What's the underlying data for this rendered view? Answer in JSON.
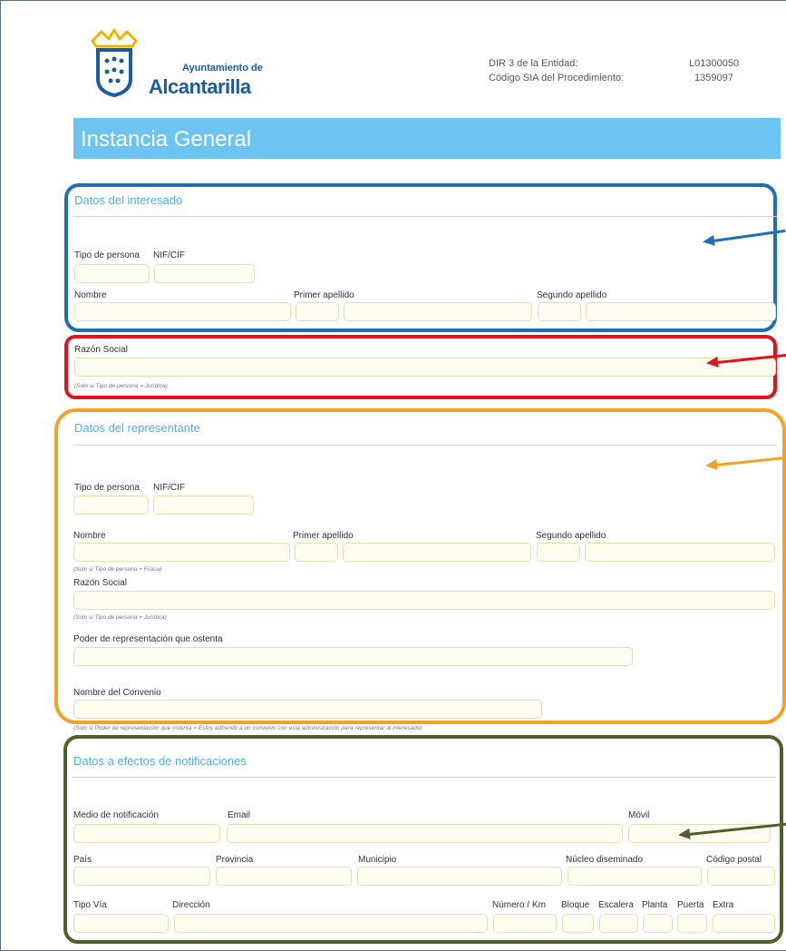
{
  "header": {
    "org_line1": "Ayuntamiento de",
    "org_line2": "Alcantarilla",
    "dir3_label": "DIR 3 de la Entidad:",
    "dir3_value": "L01300050",
    "sia_label": "Código SIA del Procedimiento:",
    "sia_value": "1359097"
  },
  "form_title": "Instancia General",
  "interesado": {
    "title": "Datos del interesado",
    "tipo_persona": "Tipo de persona",
    "nif": "NIF/CIF",
    "nombre": "Nombre",
    "primer_apellido": "Primer apellido",
    "segundo_apellido": "Segundo apellido"
  },
  "razon_interesado": {
    "label": "Razón Social",
    "note": "(Solo si Tipo de persona = Jurídica)"
  },
  "representante": {
    "title": "Datos del representante",
    "tipo_persona": "Tipo de persona",
    "nif": "NIF/CIF",
    "nombre": "Nombre",
    "primer_apellido": "Primer apellido",
    "segundo_apellido": "Segundo apellido",
    "note_fisica": "(Solo si Tipo de persona = Física)",
    "razon_social": "Razón Social",
    "note_juridica": "(Solo si Tipo de persona = Jurídica)",
    "poder": "Poder de representación que ostenta",
    "convenio": "Nombre del Convenio",
    "note_convenio": "(Solo si Poder de representación que ostenta = Estoy adherido a un convenio con esta administración para representar al interesado)"
  },
  "notificaciones": {
    "title": "Datos a efectos de notificaciones",
    "medio": "Medio de notificación",
    "email": "Email",
    "movil": "Móvil",
    "pais": "País",
    "provincia": "Provincia",
    "municipio": "Municipio",
    "nucleo": "Núcleo diseminado",
    "cp": "Código postal",
    "tipo_via": "Tipo Vía",
    "direccion": "Dirección",
    "numero": "Número / Km",
    "bloque": "Bloque",
    "escalera": "Escalera",
    "planta": "Planta",
    "puerta": "Puerta",
    "extra": "Extra"
  },
  "colors": {
    "blue_box": "#1f6fb5",
    "red_box": "#e3121b",
    "orange_box": "#f2a225",
    "green_box": "#4e5f2c",
    "title_bar": "#6cc4f2"
  }
}
